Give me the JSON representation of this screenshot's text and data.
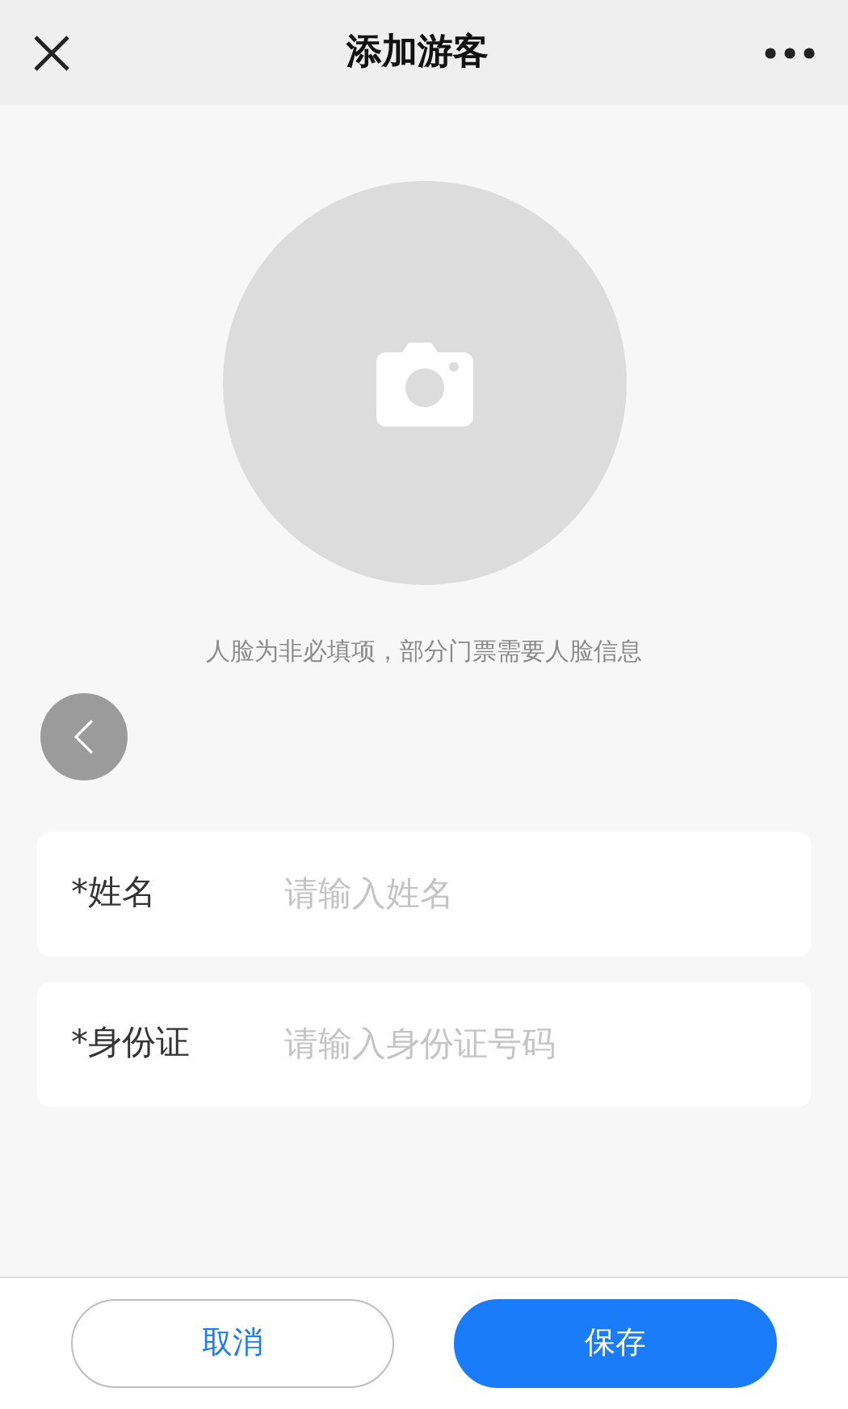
{
  "header": {
    "title": "添加游客"
  },
  "photo": {
    "hint": "人脸为非必填项，部分门票需要人脸信息"
  },
  "fields": [
    {
      "label": "*姓名",
      "placeholder": "请输入姓名"
    },
    {
      "label": "*身份证",
      "placeholder": "请输入身份证号码"
    }
  ],
  "buttons": [
    {
      "label": "取消",
      "kind": "secondary"
    },
    {
      "label": "保存",
      "kind": "primary"
    }
  ]
}
